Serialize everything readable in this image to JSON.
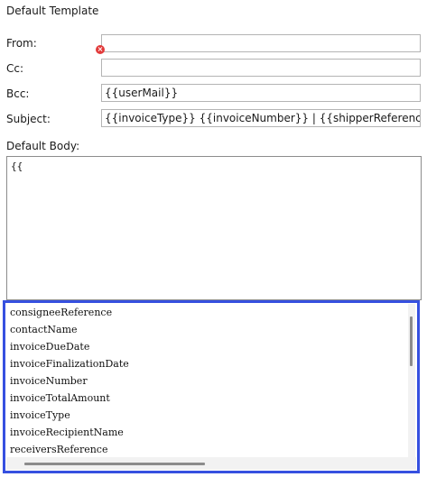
{
  "header": {
    "title": "Default Template"
  },
  "form": {
    "from": {
      "label": "From:",
      "value": ""
    },
    "cc": {
      "label": "Cc:",
      "value": ""
    },
    "bcc": {
      "label": "Bcc:",
      "value": "{{userMail}}"
    },
    "subject": {
      "label": "Subject:",
      "value": "{{invoiceType}} {{invoiceNumber}} | {{shipperReference}} | {{consig"
    },
    "body": {
      "label": "Default Body:",
      "value": "{{"
    }
  },
  "autocomplete": {
    "items": [
      "consigneeReference",
      "contactName",
      "invoiceDueDate",
      "invoiceFinalizationDate",
      "invoiceNumber",
      "invoiceTotalAmount",
      "invoiceType",
      "invoiceRecipientName",
      "receiversReference"
    ]
  },
  "colors": {
    "highlight_border": "#3650e0",
    "error": "#e23a3a"
  },
  "icons": {
    "error": "error-icon"
  }
}
